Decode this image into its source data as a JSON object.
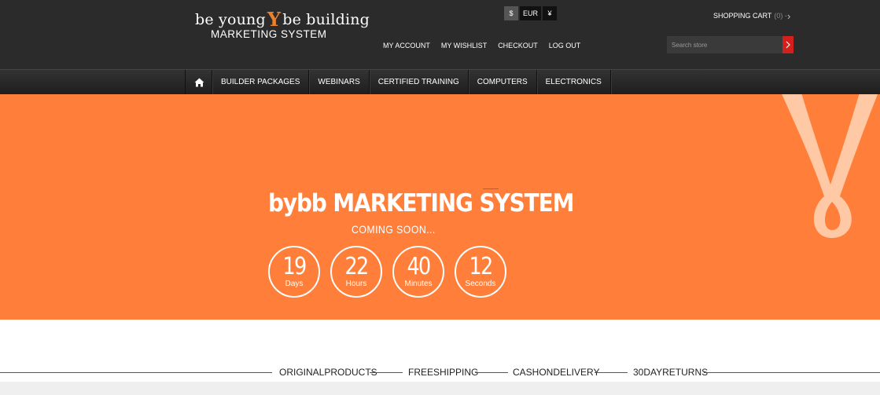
{
  "brand": {
    "logo_part1": "be young",
    "logo_mark": "Y",
    "logo_part2": "be building",
    "logo_line2": "MARKETING SYSTEM"
  },
  "currency": {
    "options": [
      "$",
      "EUR",
      "¥"
    ],
    "selected": "$"
  },
  "cart": {
    "label": "SHOPPING CART",
    "count": "(0) -"
  },
  "toplinks": [
    "MY ACCOUNT",
    "MY WISHLIST",
    "CHECKOUT",
    "LOG OUT"
  ],
  "search": {
    "placeholder": "Search store"
  },
  "nav": {
    "items": [
      "BUILDER PACKAGES",
      "WEBINARS",
      "CERTIFIED TRAINING",
      "COMPUTERS",
      "ELECTRONICS"
    ]
  },
  "hero": {
    "title": "bybb MARKETING SYSTEM",
    "subtitle": "COMING SOON...",
    "countdown": [
      {
        "value": "19",
        "label": "Days"
      },
      {
        "value": "22",
        "label": "Hours"
      },
      {
        "value": "40",
        "label": "Minutes"
      },
      {
        "value": "12",
        "label": "Seconds"
      }
    ]
  },
  "features": [
    "ORIGINALPRODUCTS",
    "FREESHIPPING",
    "CASHONDELIVERY",
    "30DAYRETURNS"
  ],
  "colors": {
    "header_bg": "#2b2b2b",
    "hero_bg": "#ff7f3a",
    "accent": "#e8822f",
    "search_button": "#d4201c"
  }
}
